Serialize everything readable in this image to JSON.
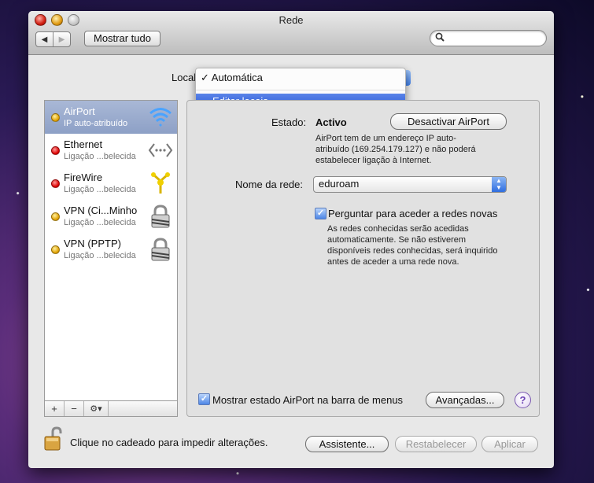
{
  "window": {
    "title": "Rede"
  },
  "toolbar": {
    "back": "◀",
    "forward": "▶",
    "show_all": "Mostrar tudo",
    "search_placeholder": ""
  },
  "location": {
    "label": "Local",
    "menu": {
      "selected_item": "✓ Automática",
      "edit_item": "Editar locais..."
    }
  },
  "services": [
    {
      "name": "AirPort",
      "status": "IP auto-atribuído",
      "dot": "yellow",
      "icon": "wifi-icon",
      "selected": true
    },
    {
      "name": "Ethernet",
      "status": "Ligação ...belecida",
      "dot": "red",
      "icon": "ethernet-icon"
    },
    {
      "name": "FireWire",
      "status": "Ligação ...belecida",
      "dot": "red",
      "icon": "firewire-icon"
    },
    {
      "name": "VPN (Ci...Minho",
      "status": "Ligação ...belecida",
      "dot": "yellow",
      "icon": "lock-icon"
    },
    {
      "name": "VPN (PPTP)",
      "status": "Ligação ...belecida",
      "dot": "yellow",
      "icon": "lock-icon"
    }
  ],
  "sidebar_buttons": {
    "add": "+",
    "remove": "−",
    "action": "⚙▾"
  },
  "detail": {
    "status_label": "Estado:",
    "status_value": "Activo",
    "toggle_button": "Desactivar AirPort",
    "status_desc_1": "AirPort tem de um endereço IP auto-",
    "status_desc_2": "atribuído (169.254.179.127) e não poderá",
    "status_desc_3": "estabelecer ligação à Internet.",
    "network_label": "Nome da rede:",
    "network_value": "eduroam",
    "ask_checkbox_label": "Perguntar para aceder a redes novas",
    "ask_desc_1": "As redes conhecidas serão acedidas",
    "ask_desc_2": "automaticamente. Se não estiverem",
    "ask_desc_3": "disponíveis redes conhecidas, será inquirido",
    "ask_desc_4": "antes de aceder a uma rede nova.",
    "menubar_checkbox_label": "Mostrar estado AirPort na barra de menus",
    "advanced_button": "Avançadas...",
    "help": "?"
  },
  "footer": {
    "lock_text": "Clique no cadeado para impedir alterações.",
    "assistant": "Assistente...",
    "revert": "Restabelecer",
    "apply": "Aplicar"
  },
  "colors": {
    "selection": "#2b5ad8",
    "sidebar_selected": "#8da0c6"
  }
}
